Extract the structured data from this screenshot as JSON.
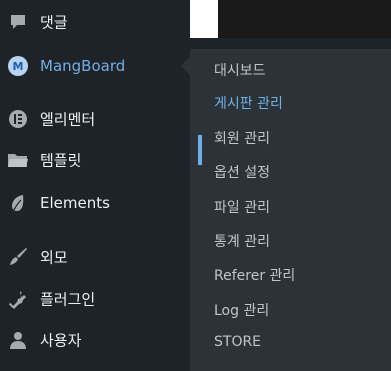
{
  "menu": {
    "items": [
      {
        "label": "댓글",
        "icon": "comment-icon"
      },
      {
        "label": "MangBoard",
        "icon": "mangboard-icon",
        "icon_text": "M",
        "active": true
      },
      {
        "label": "엘리멘터",
        "icon": "elementor-icon"
      },
      {
        "label": "템플릿",
        "icon": "folder-icon"
      },
      {
        "label": "Elements",
        "icon": "leaf-icon"
      },
      {
        "label": "외모",
        "icon": "brush-icon"
      },
      {
        "label": "플러그인",
        "icon": "plug-icon"
      },
      {
        "label": "사용자",
        "icon": "user-icon"
      }
    ]
  },
  "submenu": {
    "items": [
      {
        "label": "대시보드"
      },
      {
        "label": "게시판 관리",
        "current": true
      },
      {
        "label": "회원 관리"
      },
      {
        "label": "옵션 설정"
      },
      {
        "label": "파일 관리"
      },
      {
        "label": "통계 관리"
      },
      {
        "label": "Referer 관리"
      },
      {
        "label": "Log 관리"
      },
      {
        "label": "STORE"
      }
    ]
  },
  "colors": {
    "sidebar_bg": "#1d2327",
    "flyout_bg": "#2c3338",
    "accent": "#72aee6",
    "text": "#f0f0f1",
    "subtext": "#c3c4c7"
  }
}
